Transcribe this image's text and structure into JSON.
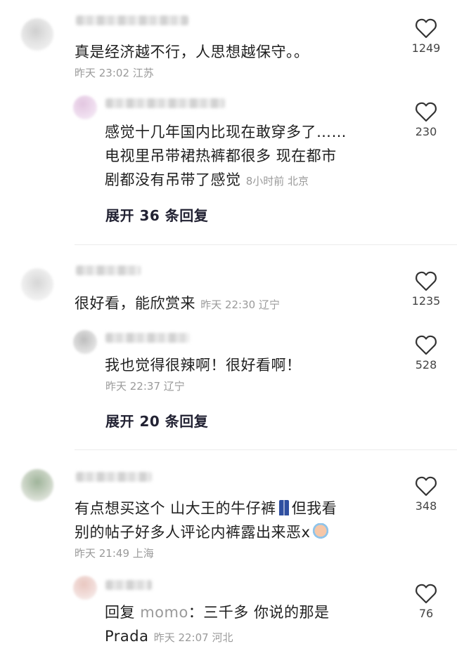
{
  "comments": [
    {
      "text": "真是经济越不行，人思想越保守。。",
      "meta": "昨天 23:02 江苏",
      "likes": "1249",
      "reply": {
        "line1": "感觉十几年国内比现在敢穿多了……",
        "line2": "电视里吊带裙热裤都很多 现在都市",
        "line3": "剧都没有吊带了感觉",
        "meta": "8小时前 北京",
        "likes": "230"
      },
      "expand": "展开 36 条回复"
    },
    {
      "text": "很好看，能欣赏来",
      "meta": "昨天 22:30 辽宁",
      "likes": "1235",
      "reply": {
        "text": "我也觉得很辣啊！很好看啊！",
        "meta": "昨天 22:37 辽宁",
        "likes": "528"
      },
      "expand": "展开 20 条回复"
    },
    {
      "line1a": "有点想买这个 山大王的牛仔裤",
      "line1b": "但我看",
      "line2": "别的帖子好多人评论内裤露出来恶x",
      "meta": "昨天 21:49 上海",
      "likes": "348",
      "reply": {
        "prefix": "回复",
        "name": "momo",
        "line1": "：三千多 你说的那是",
        "line2": "Prada",
        "meta": "昨天 22:07 河北",
        "likes": "76"
      }
    }
  ],
  "icons": {
    "like": "heart-outline-icon",
    "jeans": "jeans-emoji",
    "cry": "crying-emoji"
  }
}
